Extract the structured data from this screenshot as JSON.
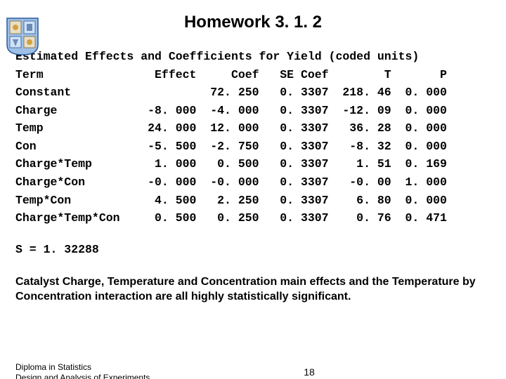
{
  "title": "Homework 3. 1. 2",
  "table_header": "Estimated Effects and Coefficients for Yield (coded units)",
  "columns": {
    "term": "Term",
    "effect": "Effect",
    "coef": "Coef",
    "se": "SE Coef",
    "t": "T",
    "p": "P"
  },
  "rows": [
    {
      "term": "Constant",
      "effect": "",
      "coef": "72. 250",
      "se": "0. 3307",
      "t": "218. 46",
      "p": "0. 000"
    },
    {
      "term": "Charge",
      "effect": "-8. 000",
      "coef": "-4. 000",
      "se": "0. 3307",
      "t": "-12. 09",
      "p": "0. 000"
    },
    {
      "term": "Temp",
      "effect": "24. 000",
      "coef": "12. 000",
      "se": "0. 3307",
      "t": "36. 28",
      "p": "0. 000"
    },
    {
      "term": "Con",
      "effect": "-5. 500",
      "coef": "-2. 750",
      "se": "0. 3307",
      "t": "-8. 32",
      "p": "0. 000"
    },
    {
      "term": "Charge*Temp",
      "effect": "1. 000",
      "coef": "0. 500",
      "se": "0. 3307",
      "t": "1. 51",
      "p": "0. 169"
    },
    {
      "term": "Charge*Con",
      "effect": "-0. 000",
      "coef": "-0. 000",
      "se": "0. 3307",
      "t": "-0. 00",
      "p": "1. 000"
    },
    {
      "term": "Temp*Con",
      "effect": "4. 500",
      "coef": "2. 250",
      "se": "0. 3307",
      "t": "6. 80",
      "p": "0. 000"
    },
    {
      "term": "Charge*Temp*Con",
      "effect": "0. 500",
      "coef": "0. 250",
      "se": "0. 3307",
      "t": "0. 76",
      "p": "0. 471"
    }
  ],
  "s_line": "S = 1. 32288",
  "summary": "Catalyst Charge, Temperature and Concentration main effects and the Temperature by Concentration interaction are all highly statistically significant.",
  "footer_line1": "Diploma in Statistics",
  "footer_line2": "Design and Analysis of Experiments",
  "page_number": "18"
}
